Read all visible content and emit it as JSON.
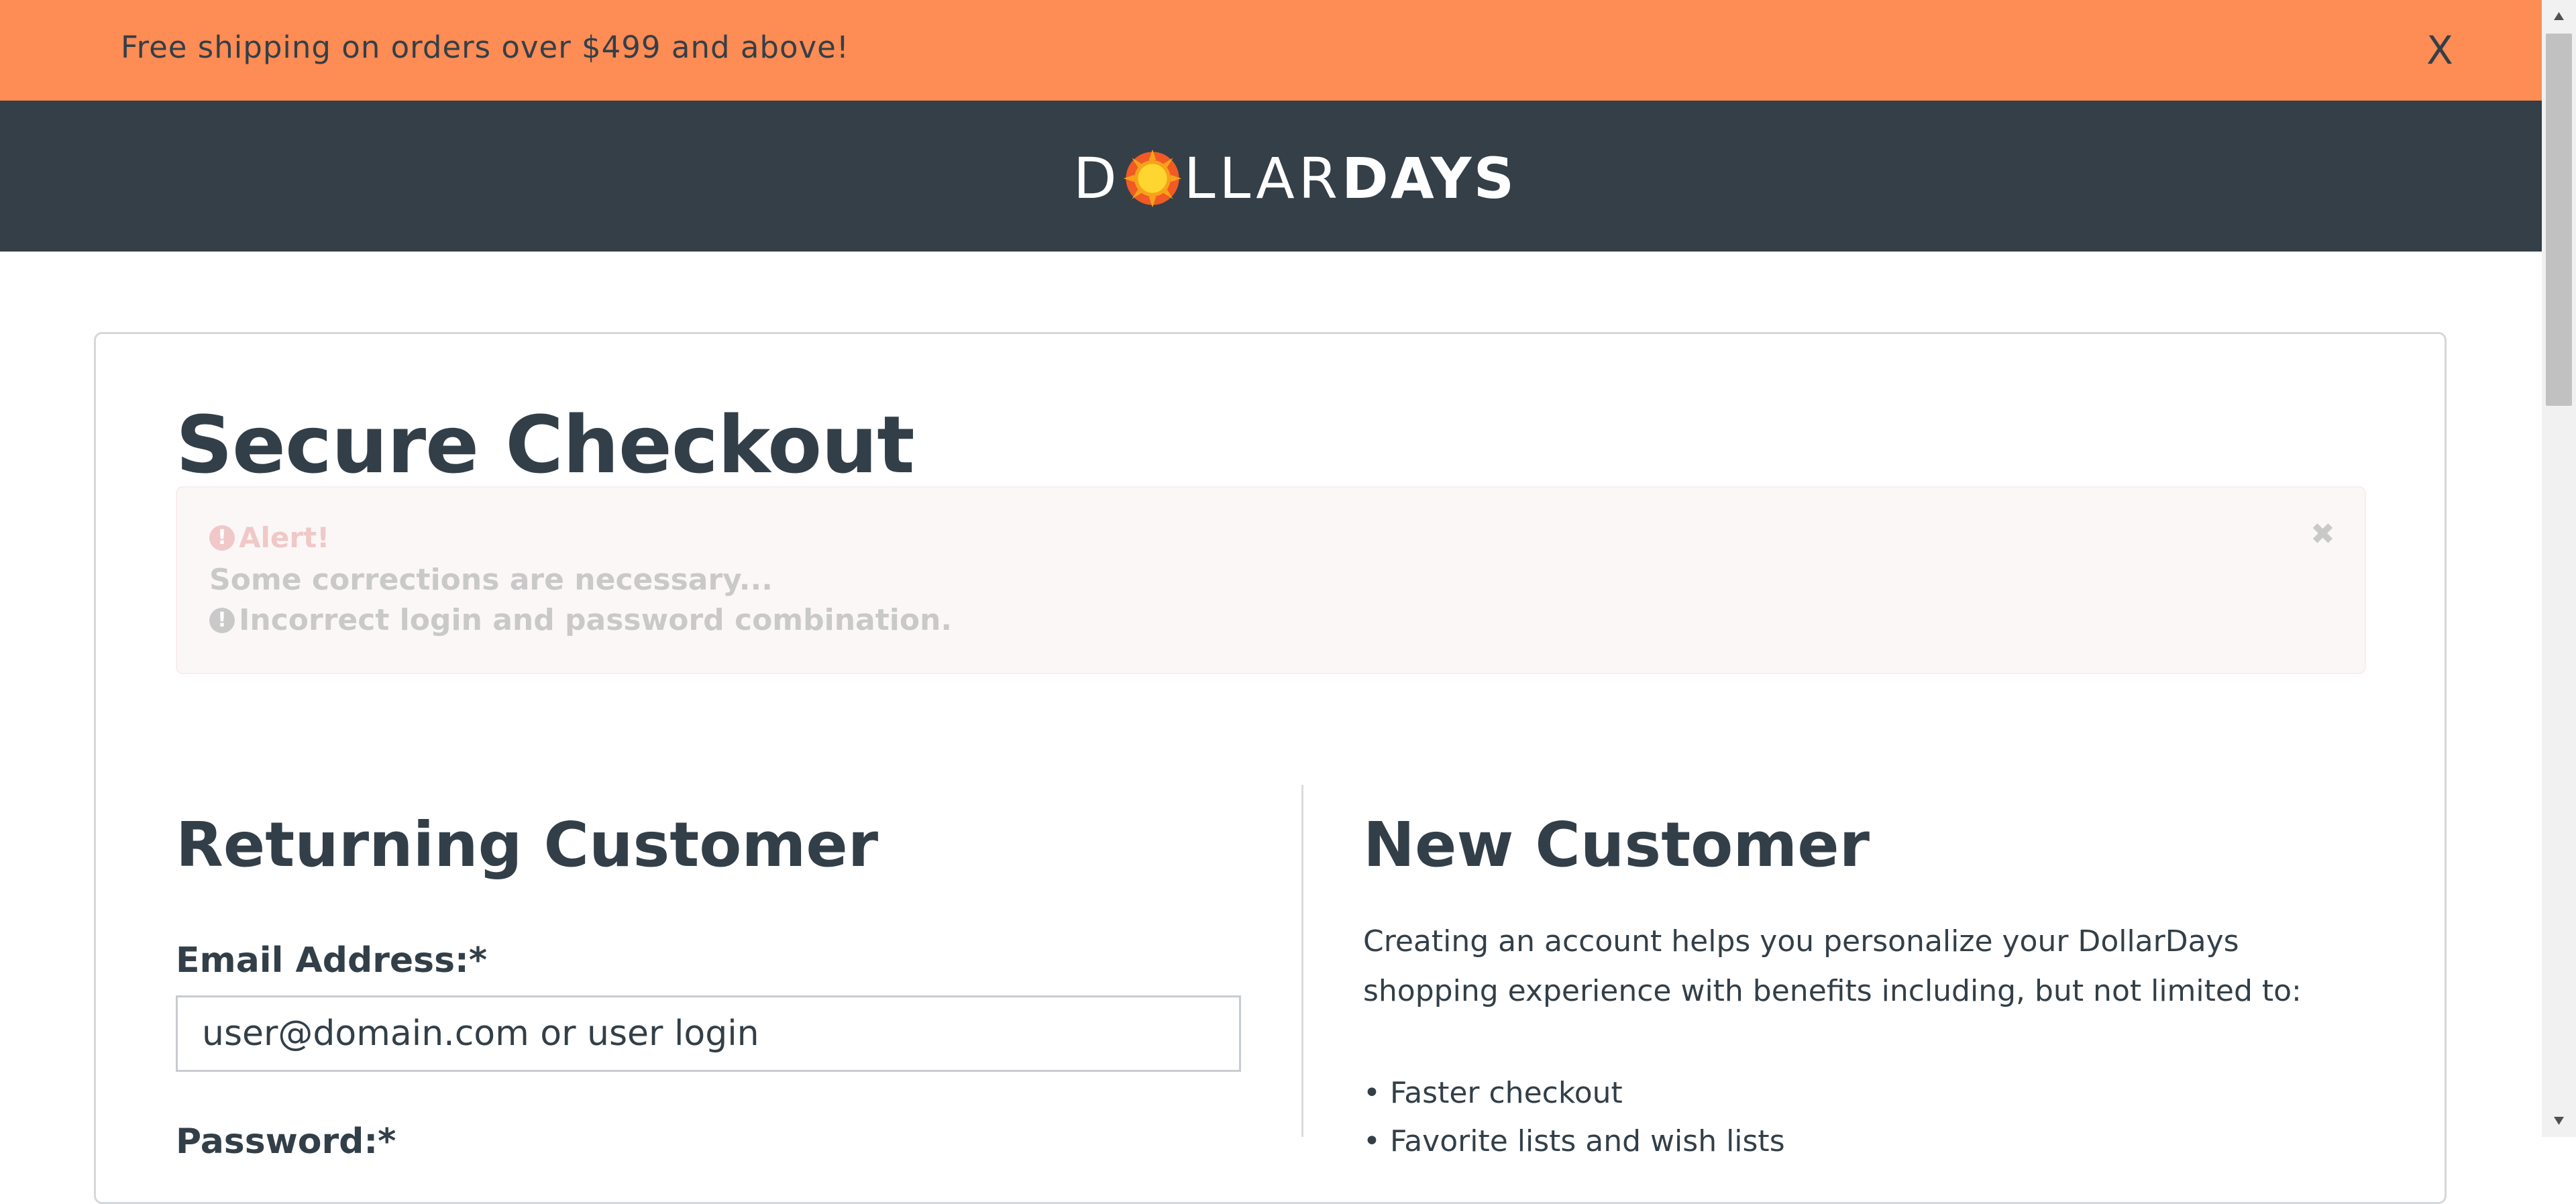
{
  "promo": {
    "text": "Free shipping on orders over $499 and above!",
    "close_label": "X",
    "background": "#fd8c55"
  },
  "header": {
    "logo": {
      "part1": "D",
      "part2": "LLAR",
      "part3": "DAYS"
    },
    "background": "#343f48"
  },
  "page": {
    "title": "Secure Checkout"
  },
  "alert": {
    "title": "Alert!",
    "message": "Some corrections are necessary...",
    "error": "Incorrect login and password combination.",
    "close_icon": "close-icon"
  },
  "returning": {
    "title": "Returning Customer",
    "email_label": "Email Address:*",
    "email_placeholder": "user@domain.com or user login",
    "password_label": "Password:*"
  },
  "new_customer": {
    "title": "New Customer",
    "description": "Creating an account helps you personalize your DollarDays shopping experience with benefits including, but not limited to:",
    "benefits": [
      "• Faster checkout",
      "• Favorite lists and wish lists"
    ]
  },
  "colors": {
    "text_dark": "#333f48",
    "accent_orange": "#fd8c55",
    "logo_sun": "#f7a21b"
  }
}
